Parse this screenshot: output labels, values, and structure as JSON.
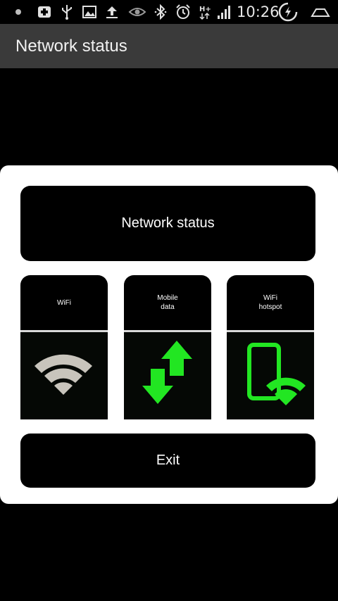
{
  "status_bar": {
    "time": "10:26",
    "icons": [
      "notification-dot-icon",
      "plus-icon",
      "usb-icon",
      "image-icon",
      "upload-icon",
      "eye-icon",
      "bluetooth-icon",
      "alarm-icon",
      "hplus-data-icon",
      "signal-icon",
      "battery-charging-icon",
      "home-icon"
    ]
  },
  "action_bar": {
    "title": "Network status"
  },
  "dialog": {
    "title_button": "Network status",
    "tiles": [
      {
        "label": "WiFi",
        "icon": "wifi-icon"
      },
      {
        "label": "Mobile\ndata",
        "icon": "mobile-data-icon"
      },
      {
        "label": "WiFi\nhotspot",
        "icon": "wifi-hotspot-icon"
      }
    ],
    "exit_button": "Exit"
  },
  "colors": {
    "accent_green": "#22e622",
    "wifi_gray": "#c8c4bc",
    "action_bar": "#3a3a3a"
  }
}
